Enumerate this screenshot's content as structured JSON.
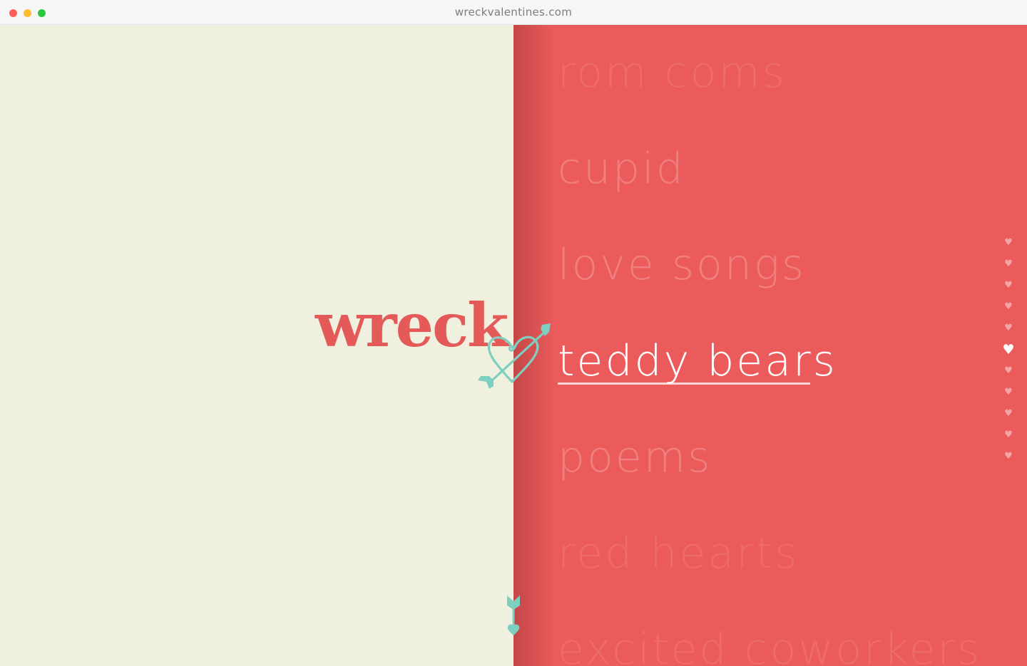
{
  "browser": {
    "url": "wreckvalentines.com",
    "controls": {
      "close_color": "#ff5f57",
      "minimize_color": "#febc2e",
      "maximize_color": "#28c840"
    }
  },
  "colors": {
    "left_background": "#f0f0df",
    "right_background": "#ec5b5c",
    "logo_red": "#e45a59",
    "accent_teal": "#7fcfc1"
  },
  "logo": {
    "word": "wreck",
    "icon": "heart-with-arrow-icon"
  },
  "topics": {
    "items": [
      {
        "label": "rom coms"
      },
      {
        "label": "cupid"
      },
      {
        "label": "love songs"
      },
      {
        "label": "teddy bears"
      },
      {
        "label": "poems"
      },
      {
        "label": "red hearts"
      },
      {
        "label": "excited coworkers"
      }
    ],
    "active_index": 3
  },
  "pager": {
    "icon": "heart-icon",
    "count": 11,
    "active_index": 5
  },
  "scroll_hint": {
    "icon": "arrow-down-icon"
  }
}
